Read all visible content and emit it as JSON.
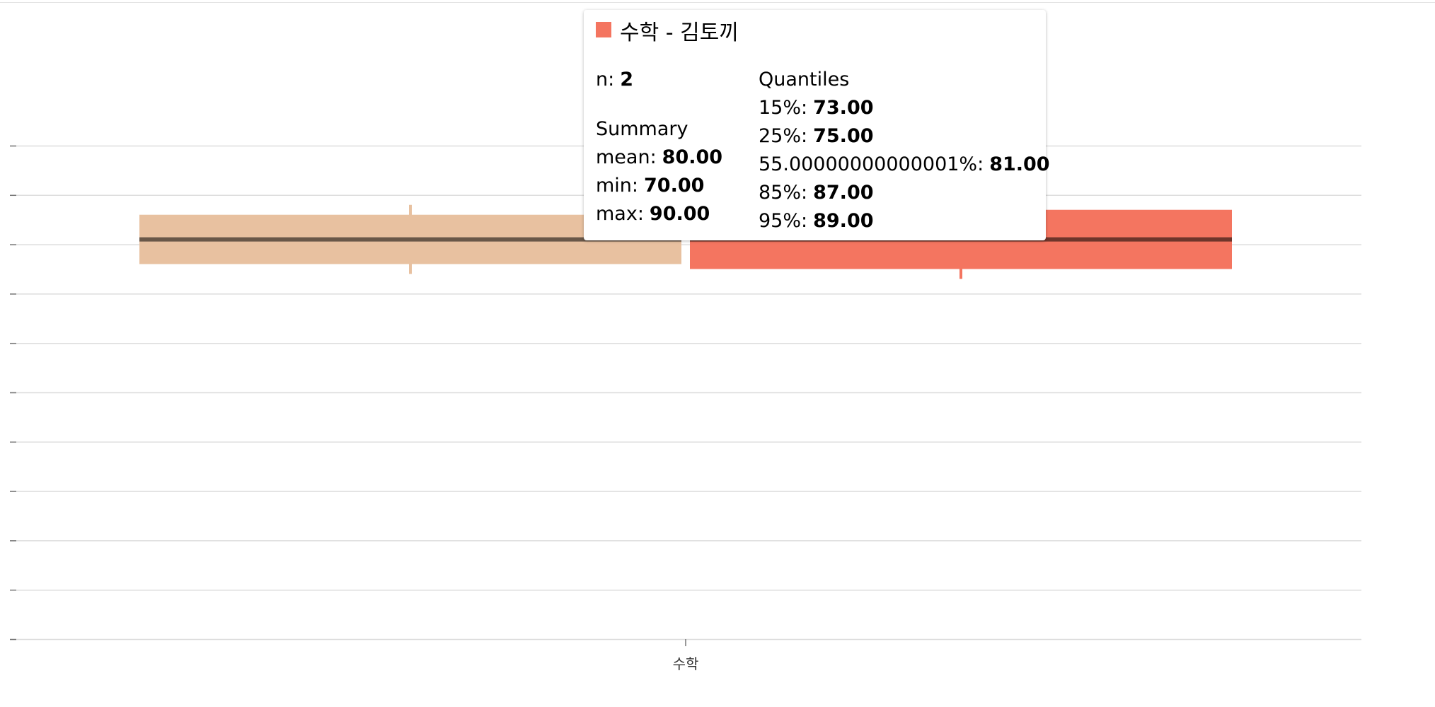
{
  "chart_data": {
    "type": "box",
    "x_categories": [
      "수학"
    ],
    "y_range": [
      0,
      100
    ],
    "series": [
      {
        "name": "",
        "color": "#e8c1a0",
        "whisker_low": 74,
        "q1": 76,
        "median": 81,
        "q3": 86,
        "whisker_high": 88
      },
      {
        "name": "김토끼",
        "color": "#f47560",
        "whisker_low": 73,
        "q1": 75,
        "median": 81,
        "q3": 87,
        "whisker_high": 89
      }
    ],
    "grid": true
  },
  "tooltip": {
    "color": "#f47560",
    "title": "수학 - 김토끼",
    "n_label": "n:",
    "n_value": "2",
    "summary_heading": "Summary",
    "summary": [
      {
        "label": "mean:",
        "value": "80.00"
      },
      {
        "label": "min:",
        "value": "70.00"
      },
      {
        "label": "max:",
        "value": "90.00"
      }
    ],
    "quantiles_heading": "Quantiles",
    "quantiles": [
      {
        "label": "15%:",
        "value": "73.00"
      },
      {
        "label": "25%:",
        "value": "75.00"
      },
      {
        "label": "55.00000000000001%:",
        "value": "81.00"
      },
      {
        "label": "85%:",
        "value": "87.00"
      },
      {
        "label": "95%:",
        "value": "89.00"
      }
    ]
  }
}
